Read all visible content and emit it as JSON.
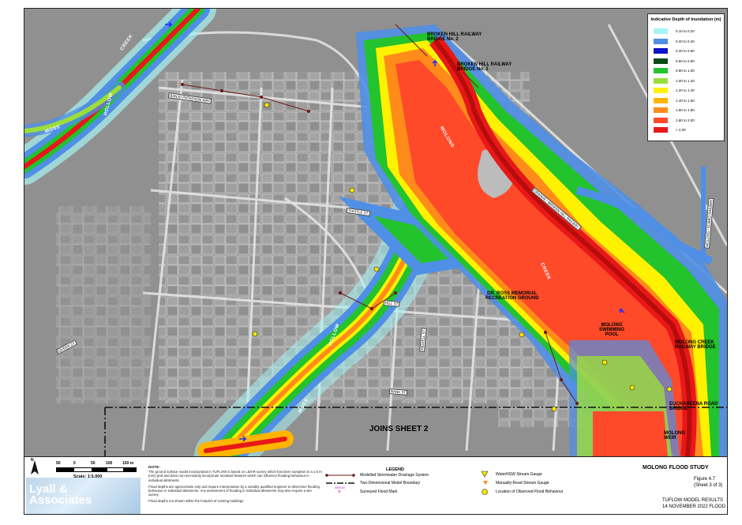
{
  "legend": {
    "title": "Indicative Depth of Inundation (m)",
    "classes": [
      {
        "label": "0.10 to 0.20",
        "color": "#a8f4f4"
      },
      {
        "label": "0.20 to 0.40",
        "color": "#4f8fe6"
      },
      {
        "label": "0.40 to 0.60",
        "color": "#0a14c8"
      },
      {
        "label": "0.60 to 0.80",
        "color": "#0a4a14"
      },
      {
        "label": "0.80 to 1.00",
        "color": "#22c32c"
      },
      {
        "label": "1.00 to 1.20",
        "color": "#9cdc3c"
      },
      {
        "label": "1.20 to 1.40",
        "color": "#fff200"
      },
      {
        "label": "1.40 to 1.60",
        "color": "#ffb400"
      },
      {
        "label": "1.60 to 1.80",
        "color": "#ff8c1a"
      },
      {
        "label": "1.80 to 2.00",
        "color": "#ff4a2a"
      },
      {
        "label": "> 2.00",
        "color": "#e81818"
      }
    ]
  },
  "map_labels": {
    "bridge2": "BROKEN HILL RAILWAY\nBRIDGE No. 2",
    "bridge1": "BROKEN HILL RAILWAY\nBRIDGE No. 1",
    "ground": "DR. ROSS MEMORIAL\nRECREATION GROUND",
    "pool": "MOLONG\nSWIMMING\nPOOL",
    "rail_bridge": "MOLONG CREEK\nRAILWAY BRIDGE",
    "euch_bridge": "EUCHAREENA ROAD\nBRIDGE",
    "weir": "MOLONG\nWEIR",
    "joins": "JOINS SHEET 2"
  },
  "creek_labels": {
    "creek_top": "CREEK",
    "hollow_left": "HOLLOW",
    "moss": "MOSS",
    "molong": "MOLONG",
    "creek_mid": "CREEK",
    "hollow_mid": "HOLLOW",
    "moss_bottom": "MOSS"
  },
  "roads": {
    "bank": "BANK ST",
    "thistle": "THISTLE ST",
    "orange_rail": "ORANGE / BROKEN HILL RAILWAY",
    "dubbo_rail": "MOLONG / DUBBO RAILWAY",
    "hill": "HILL ST",
    "riddell": "RIDDELL ST",
    "queen": "QUEEN ST",
    "banjo": "BANJO PATERSON WAY"
  },
  "scale": {
    "ticks": [
      "50",
      "0",
      "50",
      "100",
      "150 m"
    ],
    "label": "Scale: 1:5,000",
    "north": "N"
  },
  "logo": {
    "line1": "Lyall &",
    "line2": "Associates"
  },
  "note": {
    "heading": "NOTE:",
    "p1": "The ground surface model incorporated in TUFLOW is based on LiDAR survey which has been sampled on a 1.5 m (min) grid and does not necessarily incorporate localised features which can influence flooding behaviour in individual allotments.",
    "p2": "Flood depths are approximate only and require interpretation by a suitably qualified engineer to determine flooding behaviour in individual allotments. Any assessment of flooding in individual allotments may also require a site survey.",
    "p3": "Flood depths not shown within the footprint of existing buildings"
  },
  "legend2": {
    "title": "LEGEND",
    "drainage": "Modelled Stormwater Drainage System",
    "boundary": "Two-Dimensional Model Boundary",
    "flood_mark": "Surveyed Flood Mark",
    "flood_mark_value": "0000.00",
    "nsw_gauge": "WaterNSW Stream Gauge",
    "manual_gauge": "Manually-Read Stream Gauge",
    "observed": "Location of Observed Flood Behaviour"
  },
  "title_block": {
    "study": "MOLONG FLOOD STUDY",
    "figure": "Figure 4.7",
    "sheet": "(Sheet 3 of 3)",
    "results": "TUFLOW MODEL RESULTS",
    "event": "14 NOVEMBER 2022 FLOOD"
  }
}
